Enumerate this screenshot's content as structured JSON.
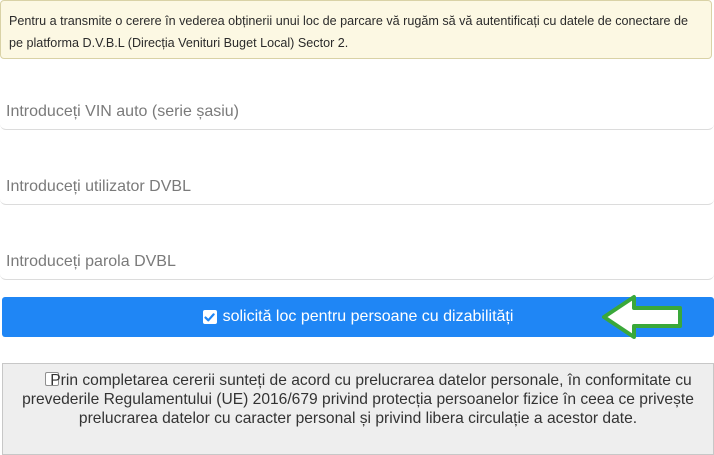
{
  "notice": {
    "text": "Pentru a transmite o cerere în vederea obținerii unui loc de parcare vă rugăm să vă autentificați cu datele de conectare de pe platforma D.V.B.L (Direcția Venituri Buget Local) Sector 2."
  },
  "form": {
    "vin_placeholder": "Introduceți VIN auto (serie șasiu)",
    "user_placeholder": "Introduceți utilizator DVBL",
    "password_placeholder": "Introduceți parola DVBL",
    "disability_label": "solicită loc pentru persoane cu dizabilități",
    "disability_checked": true,
    "consent_text": "Prin completarea cererii sunteți de acord cu prelucrarea datelor personale, în conformitate cu prevederile Regulamentului (UE) 2016/679 privind protecția persoanelor fizice în ceea ce privește prelucrarea datelor cu caracter personal și privind libera circulație a acestor date.",
    "consent_checked": false
  },
  "colors": {
    "primary": "#1f86f5",
    "notice_bg": "#fcf8e3",
    "arrow": "#3aa83a"
  },
  "icons": {
    "check": "check-icon",
    "arrow": "arrow-left-icon"
  }
}
